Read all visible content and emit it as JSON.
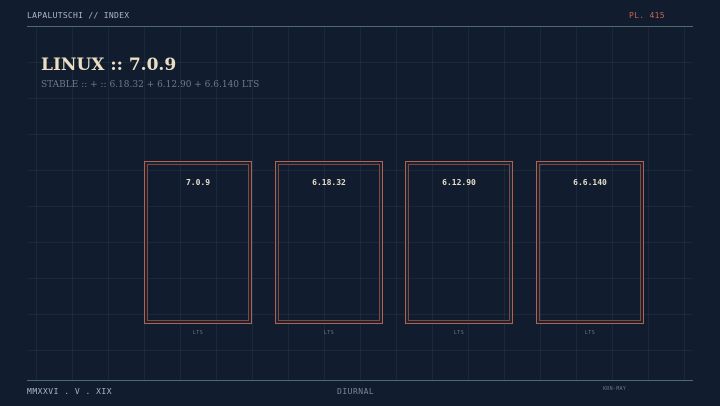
{
  "header": {
    "brand": "LAPALUTSCHI // INDEX",
    "plate": "PL. 415"
  },
  "main": {
    "title": "LINUX :: 7.0.9",
    "subtitle": "STABLE :: + :: 6.18.32 + 6.12.90 + 6.6.140 LTS",
    "cards": [
      {
        "version": "7.0.9",
        "label": "LTS"
      },
      {
        "version": "6.18.32",
        "label": "LTS"
      },
      {
        "version": "6.12.90",
        "label": "LTS"
      },
      {
        "version": "6.6.140",
        "label": "LTS"
      }
    ]
  },
  "footer": {
    "date": "MMXXVI . V . XIX",
    "cycle": "DIURNAL",
    "credit": "KRN-MAY"
  },
  "colors": {
    "background": "#111c2e",
    "accent": "#c7644f",
    "title": "#eadfc3"
  }
}
